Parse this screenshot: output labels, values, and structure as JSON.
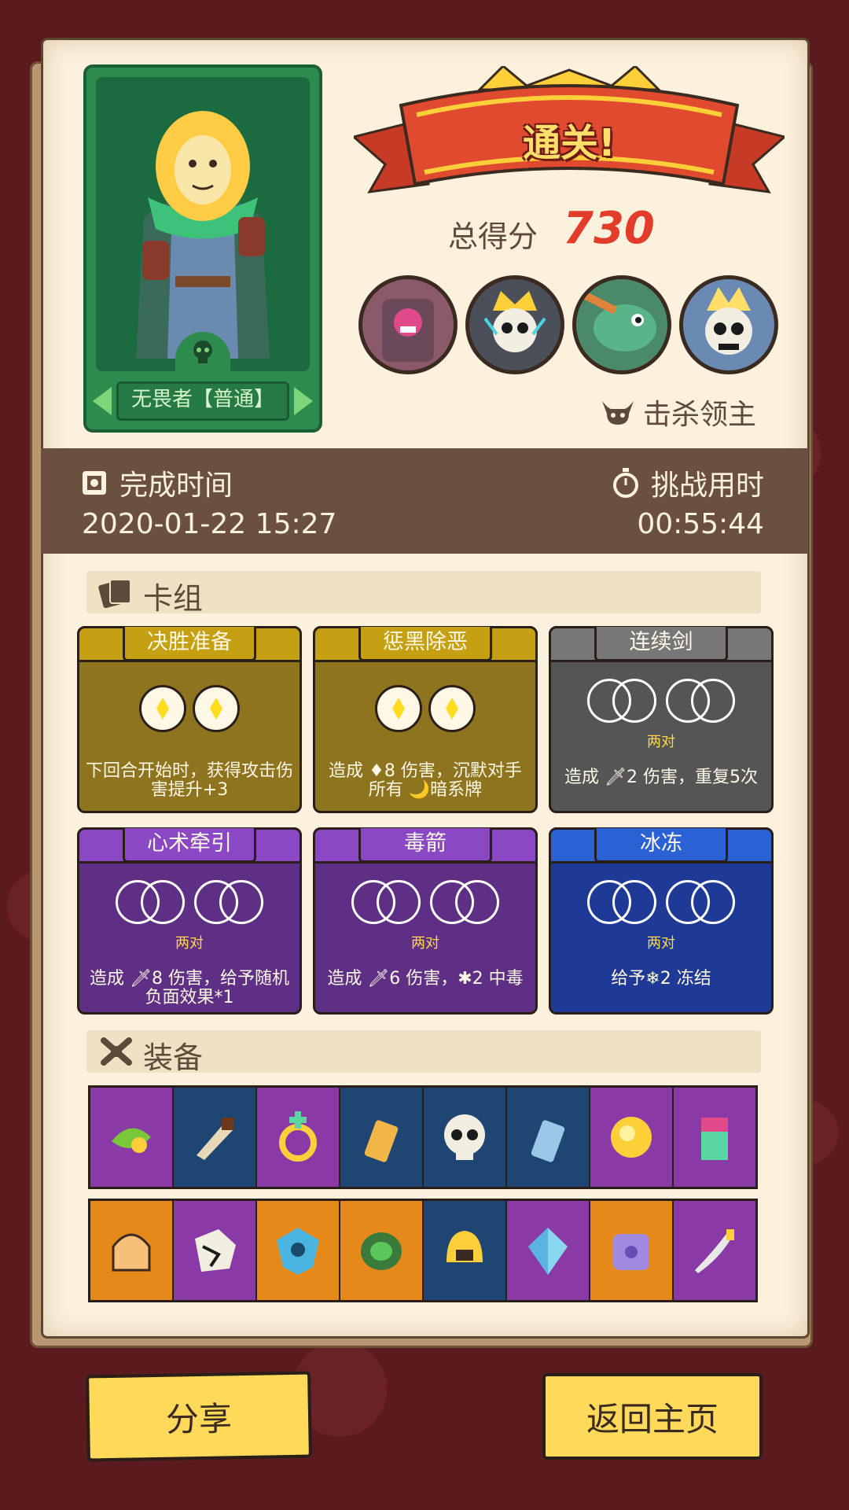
{
  "hero": {
    "name": "无畏者【普通】"
  },
  "result": {
    "banner": "通关!",
    "score_label": "总得分",
    "score": "730",
    "bosses_label": "击杀领主"
  },
  "bosses": [
    {
      "icon": "stone-golem-boss-icon",
      "color": "#8a5a6a"
    },
    {
      "icon": "crowned-skull-boss-icon",
      "color": "#4a4f5a"
    },
    {
      "icon": "fish-warrior-boss-icon",
      "color": "#4a8a6a"
    },
    {
      "icon": "skull-king-boss-icon",
      "color": "#6a8ab4"
    }
  ],
  "timing": {
    "finish_label": "完成时间",
    "finish_value": "2020-01-22 15:27",
    "duration_label": "挑战用时",
    "duration_value": "00:55:44"
  },
  "deck": {
    "title": "卡组",
    "cards": [
      {
        "name": "决胜准备",
        "slot": "gems",
        "desc": "下回合开始时，获得攻击伤害提升+3",
        "color": "#8f7420",
        "top": "#c4a012"
      },
      {
        "name": "惩黑除恶",
        "slot": "gems",
        "desc": "造成 ♦8 伤害，沉默对手所有 🌙暗系牌",
        "color": "#8f7420",
        "top": "#c4a012"
      },
      {
        "name": "连续剑",
        "slot": "pairs",
        "pair_label": "两对",
        "desc": "造成 🗡2 伤害，重复5次",
        "color": "#555555",
        "top": "#777777"
      },
      {
        "name": "心术牵引",
        "slot": "pairs",
        "pair_label": "两对",
        "desc": "造成 🗡8 伤害，给予随机负面效果*1",
        "color": "#5e2f84",
        "top": "#8a48c4"
      },
      {
        "name": "毒箭",
        "slot": "pairs",
        "pair_label": "两对",
        "desc": "造成 🗡6 伤害，✱2 中毒",
        "color": "#5e2f84",
        "top": "#8a48c4"
      },
      {
        "name": "冰冻",
        "slot": "pairs",
        "pair_label": "两对",
        "desc": "给予❄2 冻结",
        "color": "#1e3a96",
        "top": "#2a62d6"
      }
    ]
  },
  "equipment": {
    "title": "装备",
    "row1": [
      {
        "icon": "leaf-pendant-icon",
        "bg": "#8a3aa6"
      },
      {
        "icon": "horn-icon",
        "bg": "#1f4672"
      },
      {
        "icon": "cross-ring-icon",
        "bg": "#8a3aa6"
      },
      {
        "icon": "talisman-tag-icon",
        "bg": "#1f4672"
      },
      {
        "icon": "skull-icon",
        "bg": "#1f4672"
      },
      {
        "icon": "ice-tag-icon",
        "bg": "#1f4672"
      },
      {
        "icon": "golden-orb-icon",
        "bg": "#8a3aa6"
      },
      {
        "icon": "totem-icon",
        "bg": "#8a3aa6"
      }
    ],
    "row2": [
      {
        "icon": "helmet-icon",
        "bg": "#e58a1a"
      },
      {
        "icon": "cracked-stone-icon",
        "bg": "#8a3aa6"
      },
      {
        "icon": "crystal-shield-icon",
        "bg": "#e58a1a"
      },
      {
        "icon": "green-gem-icon",
        "bg": "#e58a1a"
      },
      {
        "icon": "golden-helmet-icon",
        "bg": "#1f4672"
      },
      {
        "icon": "water-crystal-icon",
        "bg": "#8a3aa6"
      },
      {
        "icon": "moon-dice-icon",
        "bg": "#e58a1a"
      },
      {
        "icon": "dagger-icon",
        "bg": "#8a3aa6"
      }
    ]
  },
  "buttons": {
    "share": "分享",
    "home": "返回主页"
  }
}
